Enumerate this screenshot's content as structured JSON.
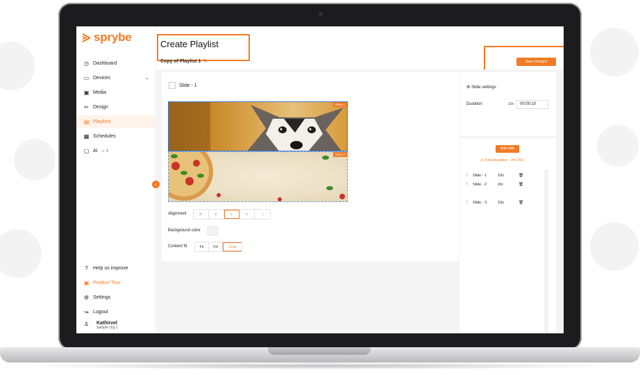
{
  "app": {
    "brand": "sprybe"
  },
  "sidebar": {
    "items": [
      {
        "label": "Dashboard",
        "icon": "dashboard-icon"
      },
      {
        "label": "Devices",
        "icon": "devices-icon"
      },
      {
        "label": "Media",
        "icon": "media-icon"
      },
      {
        "label": "Design",
        "icon": "design-icon"
      },
      {
        "label": "Playlists",
        "icon": "playlist-icon",
        "active": true
      },
      {
        "label": "Schedules",
        "icon": "calendar-icon"
      },
      {
        "label": "AI",
        "icon": "ai-icon"
      }
    ],
    "bottom_items": [
      {
        "label": "Help us improve",
        "icon": "help-icon"
      },
      {
        "label": "Product Tour",
        "icon": "tour-icon"
      },
      {
        "label": "Settings",
        "icon": "gear-icon"
      },
      {
        "label": "Logout",
        "icon": "logout-icon"
      }
    ],
    "user": {
      "name": "Kathirvel",
      "org": "Sample Org 1"
    }
  },
  "header": {
    "title": "Create Playlist",
    "playlist_name": "Copy of Playlist 1",
    "save_label": "Save changes"
  },
  "editor": {
    "slide_title": "Slide - 1",
    "zones": [
      {
        "label": "Zone 1"
      },
      {
        "label": "Zone 2"
      }
    ],
    "alignment_label": "Alignment",
    "background_label": "Background color",
    "content_fit_label": "Content fit",
    "content_fit_options": [
      "Fit",
      "Fill",
      "Crop"
    ],
    "content_fit_selected": "Crop"
  },
  "slide_settings": {
    "title": "Slide settings",
    "duration_label": "Duration",
    "duration_unit": "10s",
    "duration_value": "00:00:10"
  },
  "slide_list": {
    "add_label": "Add slide",
    "total_label": "Total duration - 2m 20s",
    "rows": [
      {
        "name": "Slide - 1",
        "duration": "10s"
      },
      {
        "name": "Slide - 2",
        "duration": "2m"
      },
      {
        "name": "Slide - 3",
        "duration": "10s"
      }
    ]
  },
  "colors": {
    "accent": "#f07b24",
    "selection": "#3a7bd5"
  }
}
